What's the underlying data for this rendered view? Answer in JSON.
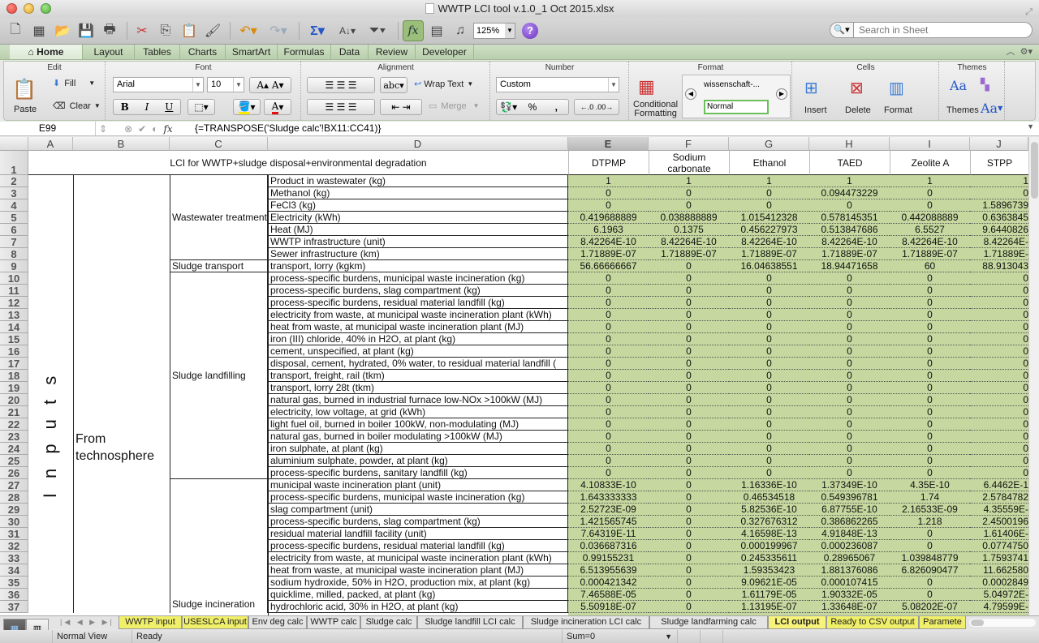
{
  "window": {
    "title": "WWTP LCI tool v.1.0_1 Oct 2015.xlsx"
  },
  "toolbar": {
    "zoom": "125%",
    "search_placeholder": "Search in Sheet"
  },
  "ribbon_tabs": [
    "Home",
    "Layout",
    "Tables",
    "Charts",
    "SmartArt",
    "Formulas",
    "Data",
    "Review",
    "Developer"
  ],
  "ribbon": {
    "groups": {
      "edit": "Edit",
      "font": "Font",
      "alignment": "Alignment",
      "number": "Number",
      "format": "Format",
      "cells": "Cells",
      "themes": "Themes"
    },
    "paste": "Paste",
    "fill": "Fill",
    "clear": "Clear",
    "font_name": "Arial",
    "font_size": "10",
    "bold": "B",
    "italic": "I",
    "underline": "U",
    "wrap_text": "Wrap Text",
    "merge": "Merge",
    "abc": "abc",
    "number_format": "Custom",
    "percent": "%",
    "comma": ",",
    "cond_format_1": "Conditional",
    "cond_format_2": "Formatting",
    "style_1": "wissenschaft-...",
    "style_2": "Normal",
    "insert": "Insert",
    "delete": "Delete",
    "format": "Format",
    "themes": "Themes",
    "aa": "Aa"
  },
  "formula_bar": {
    "cell_ref": "E99",
    "formula": "{=TRANSPOSE('Sludge calc'!BX11:CC41)}"
  },
  "columns": [
    "A",
    "B",
    "C",
    "D",
    "E",
    "F",
    "G",
    "H",
    "I",
    "J"
  ],
  "sheet": {
    "title": "LCI for WWTP+sludge disposal+environmental degradation",
    "headers": [
      "DTPMP",
      "Sodium carbonate",
      "Ethanol",
      "TAED",
      "Zeolite A",
      "STPP"
    ],
    "col_a_label": "I n p u t s",
    "col_b_label": "From technosphere",
    "groups": [
      {
        "label": "Wastewater treatment",
        "start": 2,
        "end": 8
      },
      {
        "label": "Sludge transport",
        "start": 9,
        "end": 9
      },
      {
        "label": "Sludge landfilling",
        "start": 10,
        "end": 26
      },
      {
        "label": "Sludge incineration",
        "start": 27,
        "end": 37
      }
    ],
    "rows": [
      {
        "n": 2,
        "label": "Product in wastewater (kg)",
        "values": [
          "1",
          "1",
          "1",
          "1",
          "1",
          "1"
        ]
      },
      {
        "n": 3,
        "label": "Methanol (kg)",
        "values": [
          "0",
          "0",
          "0",
          "0.094473229",
          "0",
          "0"
        ]
      },
      {
        "n": 4,
        "label": "FeCl3 (kg)",
        "values": [
          "0",
          "0",
          "0",
          "0",
          "0",
          "1.5896739"
        ]
      },
      {
        "n": 5,
        "label": "Electricity (kWh)",
        "values": [
          "0.419688889",
          "0.038888889",
          "1.015412328",
          "0.578145351",
          "0.442088889",
          "0.6363845"
        ]
      },
      {
        "n": 6,
        "label": "Heat (MJ)",
        "values": [
          "6.1963",
          "0.1375",
          "0.456227973",
          "0.513847686",
          "6.5527",
          "9.6440826"
        ]
      },
      {
        "n": 7,
        "label": "WWTP infrastructure (unit)",
        "values": [
          "8.42264E-10",
          "8.42264E-10",
          "8.42264E-10",
          "8.42264E-10",
          "8.42264E-10",
          "8.42264E-"
        ]
      },
      {
        "n": 8,
        "label": "Sewer infrastructure (km)",
        "values": [
          "1.71889E-07",
          "1.71889E-07",
          "1.71889E-07",
          "1.71889E-07",
          "1.71889E-07",
          "1.71889E-"
        ]
      },
      {
        "n": 9,
        "label": "transport, lorry (kgkm)",
        "values": [
          "56.66666667",
          "0",
          "16.04638551",
          "18.94471658",
          "60",
          "88.913043"
        ]
      },
      {
        "n": 10,
        "label": "process-specific burdens, municipal waste incineration (kg)",
        "values": [
          "0",
          "0",
          "0",
          "0",
          "0",
          "0"
        ]
      },
      {
        "n": 11,
        "label": "process-specific burdens, slag compartment (kg)",
        "values": [
          "0",
          "0",
          "0",
          "0",
          "0",
          "0"
        ]
      },
      {
        "n": 12,
        "label": "process-specific burdens, residual material landfill (kg)",
        "values": [
          "0",
          "0",
          "0",
          "0",
          "0",
          "0"
        ]
      },
      {
        "n": 13,
        "label": "electricity from waste, at municipal waste incineration plant (kWh)",
        "values": [
          "0",
          "0",
          "0",
          "0",
          "0",
          "0"
        ]
      },
      {
        "n": 14,
        "label": "heat from waste, at municipal waste incineration plant (MJ)",
        "values": [
          "0",
          "0",
          "0",
          "0",
          "0",
          "0"
        ]
      },
      {
        "n": 15,
        "label": "iron (III) chloride, 40% in H2O, at plant (kg)",
        "values": [
          "0",
          "0",
          "0",
          "0",
          "0",
          "0"
        ]
      },
      {
        "n": 16,
        "label": "cement, unspecified, at plant (kg)",
        "values": [
          "0",
          "0",
          "0",
          "0",
          "0",
          "0"
        ]
      },
      {
        "n": 17,
        "label": "disposal, cement, hydrated, 0% water, to residual material landfill (",
        "values": [
          "0",
          "0",
          "0",
          "0",
          "0",
          "0"
        ]
      },
      {
        "n": 18,
        "label": "transport, freight, rail (tkm)",
        "values": [
          "0",
          "0",
          "0",
          "0",
          "0",
          "0"
        ]
      },
      {
        "n": 19,
        "label": "transport, lorry 28t (tkm)",
        "values": [
          "0",
          "0",
          "0",
          "0",
          "0",
          "0"
        ]
      },
      {
        "n": 20,
        "label": "natural gas, burned in industrial furnace low-NOx >100kW (MJ)",
        "values": [
          "0",
          "0",
          "0",
          "0",
          "0",
          "0"
        ]
      },
      {
        "n": 21,
        "label": "electricity, low voltage, at grid (kWh)",
        "values": [
          "0",
          "0",
          "0",
          "0",
          "0",
          "0"
        ]
      },
      {
        "n": 22,
        "label": "light fuel oil, burned in boiler 100kW, non-modulating (MJ)",
        "values": [
          "0",
          "0",
          "0",
          "0",
          "0",
          "0"
        ]
      },
      {
        "n": 23,
        "label": "natural gas, burned in boiler modulating >100kW (MJ)",
        "values": [
          "0",
          "0",
          "0",
          "0",
          "0",
          "0"
        ]
      },
      {
        "n": 24,
        "label": "iron sulphate, at plant (kg)",
        "values": [
          "0",
          "0",
          "0",
          "0",
          "0",
          "0"
        ]
      },
      {
        "n": 25,
        "label": "aluminium sulphate, powder, at plant (kg)",
        "values": [
          "0",
          "0",
          "0",
          "0",
          "0",
          "0"
        ]
      },
      {
        "n": 26,
        "label": "process-specific burdens, sanitary landfill (kg)",
        "values": [
          "0",
          "0",
          "0",
          "0",
          "0",
          "0"
        ]
      },
      {
        "n": 27,
        "label": "municipal waste incineration plant (unit)",
        "values": [
          "4.10833E-10",
          "0",
          "1.16336E-10",
          "1.37349E-10",
          "4.35E-10",
          "6.4462E-1"
        ]
      },
      {
        "n": 28,
        "label": "process-specific burdens, municipal waste incineration (kg)",
        "values": [
          "1.643333333",
          "0",
          "0.46534518",
          "0.549396781",
          "1.74",
          "2.5784782"
        ]
      },
      {
        "n": 29,
        "label": "slag compartment (unit)",
        "values": [
          "2.52723E-09",
          "0",
          "5.82536E-10",
          "6.87755E-10",
          "2.16533E-09",
          "4.35559E-"
        ]
      },
      {
        "n": 30,
        "label": "process-specific burdens, slag compartment (kg)",
        "values": [
          "1.421565745",
          "0",
          "0.327676312",
          "0.386862265",
          "1.218",
          "2.4500196"
        ]
      },
      {
        "n": 31,
        "label": "residual material landfill facility (unit)",
        "values": [
          "7.64319E-11",
          "0",
          "4.16598E-13",
          "4.91848E-13",
          "0",
          "1.61406E-"
        ]
      },
      {
        "n": 32,
        "label": "process-specific burdens, residual material landfill (kg)",
        "values": [
          "0.036687316",
          "0",
          "0.000199967",
          "0.000236087",
          "0",
          "0.0774750"
        ]
      },
      {
        "n": 33,
        "label": "electricity from waste, at municipal waste incineration plant (kWh)",
        "values": [
          "0.99155231",
          "0",
          "0.245335611",
          "0.28965067",
          "1.039848779",
          "1.7593741"
        ]
      },
      {
        "n": 34,
        "label": "heat from waste, at municipal waste incineration plant (MJ)",
        "values": [
          "6.513955639",
          "0",
          "1.59353423",
          "1.881376086",
          "6.826090477",
          "11.662580"
        ]
      },
      {
        "n": 35,
        "label": "sodium hydroxide, 50% in H2O, production mix, at plant (kg)",
        "values": [
          "0.000421342",
          "0",
          "9.09621E-05",
          "0.000107415",
          "0",
          "0.0002849"
        ]
      },
      {
        "n": 36,
        "label": "quicklime, milled, packed, at plant (kg)",
        "values": [
          "7.46588E-05",
          "0",
          "1.61179E-05",
          "1.90332E-05",
          "0",
          "5.04972E-"
        ]
      },
      {
        "n": 37,
        "label": "hydrochloric acid, 30% in H2O, at plant (kg)",
        "values": [
          "5.50918E-07",
          "0",
          "1.13195E-07",
          "1.33648E-07",
          "5.08202E-07",
          "4.79599E-"
        ]
      }
    ]
  },
  "sheet_tabs": [
    {
      "label": "WWTP input",
      "style": "yellow"
    },
    {
      "label": "USESLCA input",
      "style": "yellow"
    },
    {
      "label": "Env deg calc",
      "style": ""
    },
    {
      "label": "WWTP calc",
      "style": ""
    },
    {
      "label": "Sludge calc",
      "style": ""
    },
    {
      "label": "Sludge landfill LCI calc",
      "style": ""
    },
    {
      "label": "Sludge incineration LCI calc",
      "style": ""
    },
    {
      "label": "Sludge landfarming calc",
      "style": ""
    },
    {
      "label": "LCI output",
      "style": "active"
    },
    {
      "label": "Ready to CSV output",
      "style": "yellow"
    },
    {
      "label": "Paramete",
      "style": "yellow"
    }
  ],
  "status": {
    "view": "Normal View",
    "mode": "Ready",
    "sum": "Sum=0"
  }
}
